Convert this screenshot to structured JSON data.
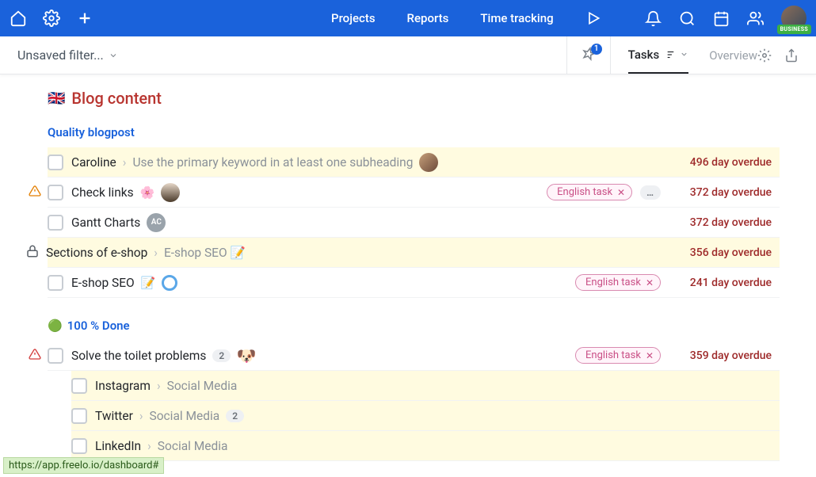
{
  "nav": {
    "projects": "Projects",
    "reports": "Reports",
    "time_tracking": "Time tracking",
    "business_badge": "BUSINESS"
  },
  "subbar": {
    "filter_label": "Unsaved filter...",
    "pin_count": "1",
    "tab_tasks": "Tasks",
    "tab_overview": "Overview"
  },
  "project": {
    "flag": "🇬🇧",
    "title": "Blog content"
  },
  "sections": [
    {
      "title": "Quality blogpost",
      "title_emoji": "",
      "tasks": [
        {
          "hl": true,
          "warn": "",
          "lock": false,
          "name": "Caroline",
          "crumb": "Use the primary keyword in at least one subheading",
          "emoji": "",
          "avatar": "photo1",
          "avatar_text": "",
          "tag": "",
          "more": false,
          "count": "",
          "overdue": "496 day overdue"
        },
        {
          "hl": false,
          "warn": "orange",
          "lock": false,
          "name": "Check links",
          "crumb": "",
          "emoji": "🌸",
          "avatar": "photo2",
          "avatar_text": "",
          "tag": "English task",
          "more": true,
          "count": "",
          "overdue": "372 day overdue"
        },
        {
          "hl": false,
          "warn": "",
          "lock": false,
          "name": "Gantt Charts",
          "crumb": "",
          "emoji": "",
          "avatar": "text",
          "avatar_text": "AC",
          "tag": "",
          "more": false,
          "count": "",
          "overdue": "372 day overdue"
        },
        {
          "hl": true,
          "warn": "",
          "lock": true,
          "name": "Sections of e-shop",
          "crumb": "E-shop SEO 📝",
          "emoji": "",
          "avatar": "",
          "avatar_text": "",
          "tag": "",
          "more": false,
          "count": "",
          "overdue": "356 day overdue"
        },
        {
          "hl": false,
          "warn": "",
          "lock": false,
          "name": "E-shop SEO",
          "crumb": "",
          "emoji": "📝",
          "avatar": "ring",
          "avatar_text": "",
          "tag": "English task",
          "more": false,
          "count": "",
          "overdue": "241 day overdue"
        }
      ]
    },
    {
      "title": "100 % Done",
      "title_emoji": "🟢",
      "tasks": [
        {
          "hl": false,
          "warn": "red",
          "lock": false,
          "name": "Solve the toilet problems",
          "crumb": "",
          "emoji": "",
          "avatar": "dog",
          "avatar_text": "🐶",
          "tag": "English task",
          "more": false,
          "count": "2",
          "overdue": "359 day overdue"
        }
      ],
      "subtasks": [
        {
          "hl": true,
          "name": "Instagram",
          "crumb": "Social Media",
          "count": ""
        },
        {
          "hl": true,
          "name": "Twitter",
          "crumb": "Social Media",
          "count": "2"
        },
        {
          "hl": true,
          "name": "LinkedIn",
          "crumb": "Social Media",
          "count": ""
        }
      ]
    }
  ],
  "tag_label": "English task",
  "status_url": "https://app.freelo.io/dashboard#"
}
